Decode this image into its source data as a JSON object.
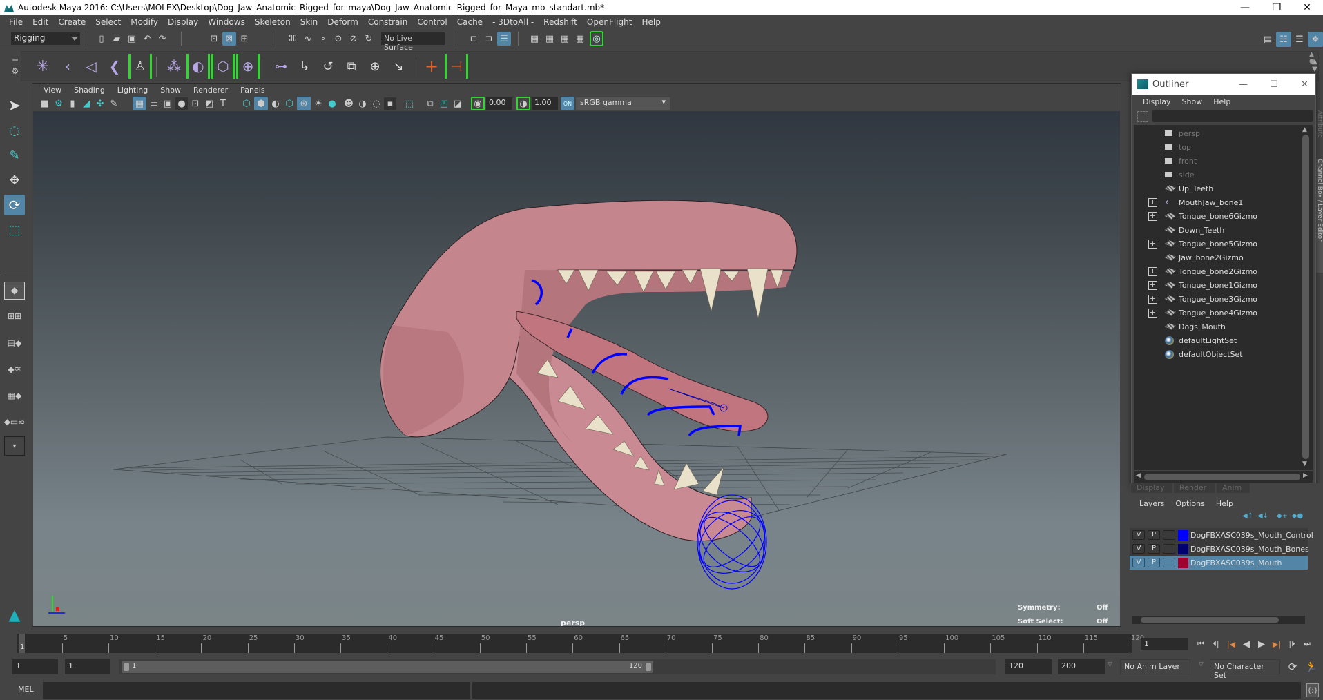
{
  "window": {
    "title": "Autodesk Maya 2016: C:\\Users\\MOLEX\\Desktop\\Dog_Jaw_Anatomic_Rigged_for_maya\\Dog_Jaw_Anatomic_Rigged_for_Maya_mb_standart.mb*",
    "controls": {
      "minimize": "—",
      "restore": "❐",
      "close": "✕"
    }
  },
  "menubar": [
    "File",
    "Edit",
    "Create",
    "Select",
    "Modify",
    "Display",
    "Windows",
    "Skeleton",
    "Skin",
    "Deform",
    "Constrain",
    "Control",
    "Cache",
    "- 3DtoAll -",
    "Redshift",
    "OpenFlight",
    "Help"
  ],
  "statusline": {
    "mode": "Rigging",
    "live_surface": "No Live Surface",
    "icons": [
      "new-scene-icon",
      "open-scene-icon",
      "save-scene-icon",
      "undo-icon",
      "redo-icon",
      "select-hierarchy-icon",
      "select-object-icon",
      "select-component-icon",
      "snap-grid-icon",
      "snap-curve-icon",
      "snap-point-icon",
      "snap-projected-icon",
      "snap-view-plane-icon",
      "snap-live-icon",
      "input-ops-icon",
      "output-ops-icon",
      "construction-history-icon",
      "render-frame-icon",
      "render-current-icon",
      "ipr-render-icon",
      "render-settings-icon",
      "hypershade-icon"
    ]
  },
  "shelf": {
    "icons": [
      "create-joints-icon",
      "insert-joint-icon",
      "mirror-joint-icon",
      "ik-handle-icon",
      "hik-skeleton-icon",
      "bind-skin-icon",
      "paint-weights-icon",
      "lattice-icon",
      "cluster-icon",
      "parent-constraint-icon",
      "point-constraint-icon",
      "orient-constraint-icon",
      "scale-constraint-icon",
      "aim-constraint-icon",
      "pole-vector-constraint-icon",
      "locator-icon",
      "locator-constraint-icon"
    ]
  },
  "toolbox": [
    "select-tool",
    "lasso-tool",
    "paint-select-tool",
    "move-tool",
    "rotate-tool",
    "scale-tool"
  ],
  "layouts": [
    "single-pane-layout",
    "four-pane-layout",
    "outliner-persp-layout",
    "graph-persp-layout",
    "hypershade-persp-layout",
    "persp-graph-hypergraph-layout",
    "more-layouts"
  ],
  "panel": {
    "menus": [
      "View",
      "Shading",
      "Lighting",
      "Show",
      "Renderer",
      "Panels"
    ],
    "exposure": "0.00",
    "gamma": "1.00",
    "color_space": "sRGB gamma",
    "color_mgmt": "ON"
  },
  "viewport": {
    "camera": "persp",
    "hud": [
      {
        "label": "Symmetry:",
        "value": "Off"
      },
      {
        "label": "Soft Select:",
        "value": "Off"
      }
    ]
  },
  "right_icons": [
    "modeling-toolkit-icon",
    "attribute-editor-icon",
    "tool-settings-icon",
    "channel-box-icon"
  ],
  "side_tabs": [
    "Attribute Editor",
    "Channel Box / Layer Editor"
  ],
  "outliner": {
    "title": "Outliner",
    "menus": [
      "Display",
      "Show",
      "Help"
    ],
    "search_value": "",
    "items": [
      {
        "name": "persp",
        "type": "camera",
        "expandable": false,
        "dim": true
      },
      {
        "name": "top",
        "type": "camera",
        "expandable": false,
        "dim": true
      },
      {
        "name": "front",
        "type": "camera",
        "expandable": false,
        "dim": true
      },
      {
        "name": "side",
        "type": "camera",
        "expandable": false,
        "dim": true
      },
      {
        "name": "Up_Teeth",
        "type": "mesh",
        "expandable": false,
        "dim": false
      },
      {
        "name": "MouthJaw_bone1",
        "type": "joint",
        "expandable": true,
        "dim": false
      },
      {
        "name": "Tongue_bone6Gizmo",
        "type": "mesh",
        "expandable": true,
        "dim": false
      },
      {
        "name": "Down_Teeth",
        "type": "mesh",
        "expandable": false,
        "dim": false
      },
      {
        "name": "Tongue_bone5Gizmo",
        "type": "mesh",
        "expandable": true,
        "dim": false
      },
      {
        "name": "Jaw_bone2Gizmo",
        "type": "mesh",
        "expandable": false,
        "dim": false
      },
      {
        "name": "Tongue_bone2Gizmo",
        "type": "mesh",
        "expandable": true,
        "dim": false
      },
      {
        "name": "Tongue_bone1Gizmo",
        "type": "mesh",
        "expandable": true,
        "dim": false
      },
      {
        "name": "Tongue_bone3Gizmo",
        "type": "mesh",
        "expandable": true,
        "dim": false
      },
      {
        "name": "Tongue_bone4Gizmo",
        "type": "mesh",
        "expandable": true,
        "dim": false
      },
      {
        "name": "Dogs_Mouth",
        "type": "mesh",
        "expandable": false,
        "dim": false
      },
      {
        "name": "defaultLightSet",
        "type": "set",
        "expandable": false,
        "dim": false
      },
      {
        "name": "defaultObjectSet",
        "type": "set",
        "expandable": false,
        "dim": false
      }
    ]
  },
  "layer_editor": {
    "tabs": [
      "Display",
      "Render",
      "Anim"
    ],
    "menus": [
      "Layers",
      "Options",
      "Help"
    ],
    "layers": [
      {
        "visible": "V",
        "playback": "P",
        "color": "#0000ff",
        "name": "DogFBXASC039s_Mouth_Control",
        "active": false
      },
      {
        "visible": "V",
        "playback": "P",
        "color": "#000070",
        "name": "DogFBXASC039s_Mouth_Bones",
        "active": false
      },
      {
        "visible": "V",
        "playback": "P",
        "color": "#a0002e",
        "name": "DogFBXASC039s_Mouth",
        "active": true
      }
    ]
  },
  "timeline": {
    "start": 1,
    "end": 120,
    "major_step": 5,
    "current_frame": "1",
    "current_frame_marker": "1",
    "playback_icons": [
      "go-to-start-icon",
      "step-back-frame-icon",
      "step-back-key-icon",
      "play-backward-icon",
      "play-forward-icon",
      "step-forward-key-icon",
      "step-forward-frame-icon",
      "go-to-end-icon"
    ]
  },
  "range": {
    "start_time": "1",
    "playback_start": "1",
    "slider_start": "1",
    "slider_end": "120",
    "playback_end": "120",
    "end_time": "200",
    "anim_layer": "No Anim Layer",
    "character_set": "No Character Set"
  },
  "command_line": {
    "label": "MEL",
    "value": "",
    "result": ""
  }
}
